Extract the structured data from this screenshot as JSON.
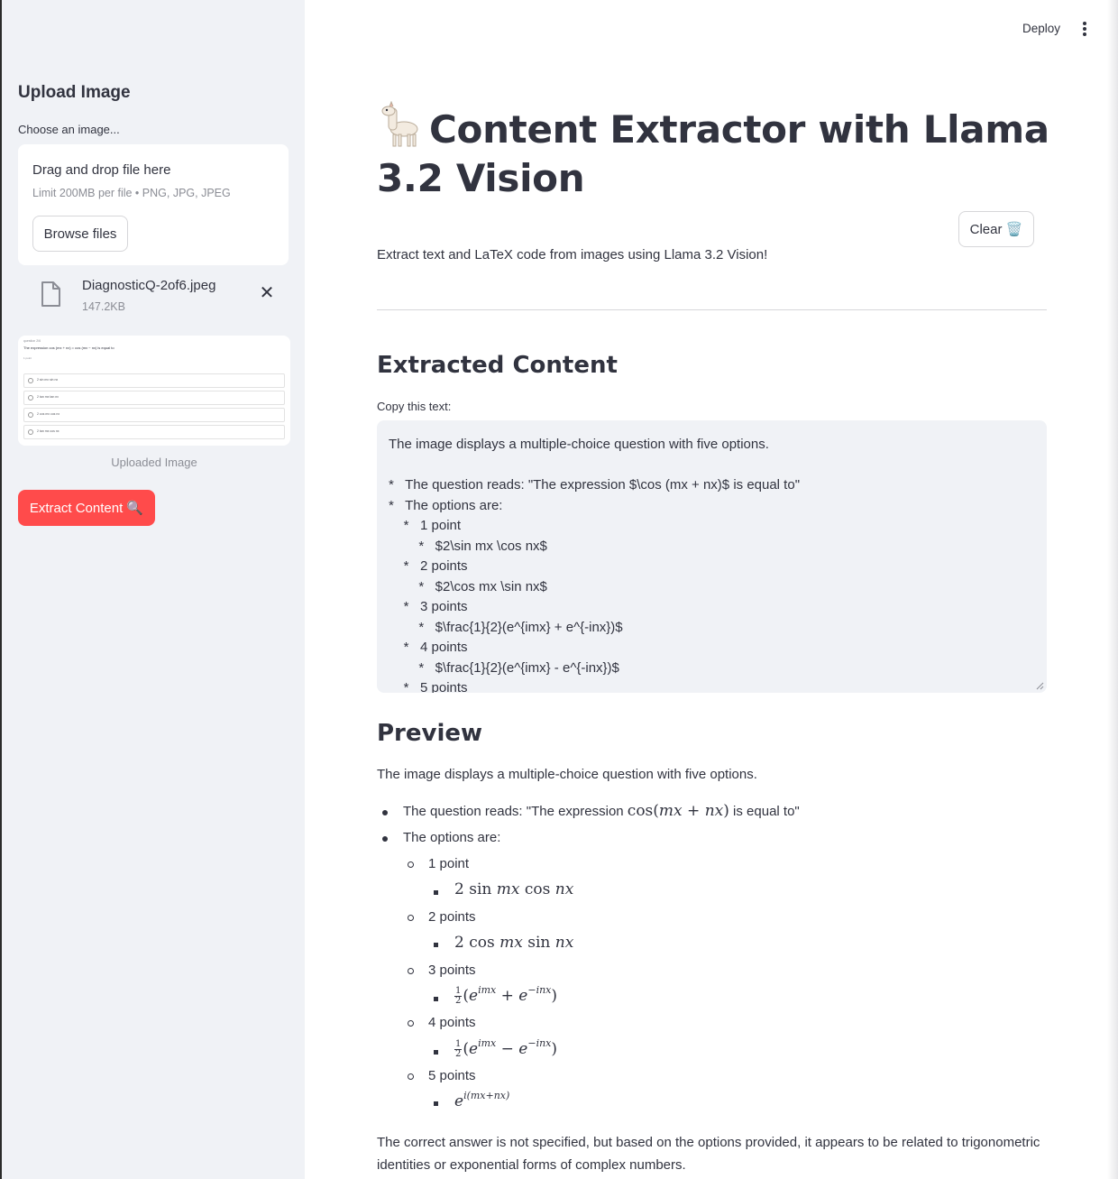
{
  "header": {
    "deploy_label": "Deploy",
    "menu_icon": "kebab-menu-icon"
  },
  "sidebar": {
    "title": "Upload Image",
    "uploader_label": "Choose an image...",
    "dropzone": {
      "main_text": "Drag and drop file here",
      "limit_text": "Limit 200MB per file • PNG, JPG, JPEG",
      "browse_label": "Browse files"
    },
    "file": {
      "name": "DiagnosticQ-2of6.jpeg",
      "size": "147.2KB"
    },
    "thumbnail": {
      "title": "question 2/6",
      "question": "The expression cos (mx + nx) = cos (mx − nx) is equal to",
      "points": "1 point",
      "options": [
        "2 sin mx sin nx",
        "2 tan mx tan nx",
        "2 cos mx cos nx",
        "2 tan mx cos nx"
      ]
    },
    "caption": "Uploaded Image",
    "extract_label": "Extract Content 🔍"
  },
  "main": {
    "title": "Content Extractor with Llama 3.2 Vision",
    "clear_label": "Clear 🗑️",
    "subtitle": "Extract text and LaTeX code from images using Llama 3.2 Vision!",
    "extracted_heading": "Extracted Content",
    "copy_label": "Copy this text:",
    "textarea_lines": [
      "The image displays a multiple-choice question with five options.",
      "",
      "*   The question reads: \"The expression $\\cos (mx + nx)$ is equal to\"",
      "*   The options are:",
      "    *   1 point",
      "        *   $2\\sin mx \\cos nx$",
      "    *   2 points",
      "        *   $2\\cos mx \\sin nx$",
      "    *   3 points",
      "        *   $\\frac{1}{2}(e^{imx} + e^{-inx})$",
      "    *   4 points",
      "        *   $\\frac{1}{2}(e^{imx} - e^{-inx})$",
      "    *   5 points"
    ],
    "preview_heading": "Preview",
    "preview": {
      "intro": "The image displays a multiple-choice question with five options.",
      "q_prefix": "The question reads: \"The expression ",
      "q_suffix": " is equal to\"",
      "options_label": "The options are:",
      "points": [
        "1 point",
        "2 points",
        "3 points",
        "4 points",
        "5 points"
      ],
      "conclusion": "The correct answer is not specified, but based on the options provided, it appears to be related to trigonometric identities or exponential forms of complex numbers."
    }
  }
}
